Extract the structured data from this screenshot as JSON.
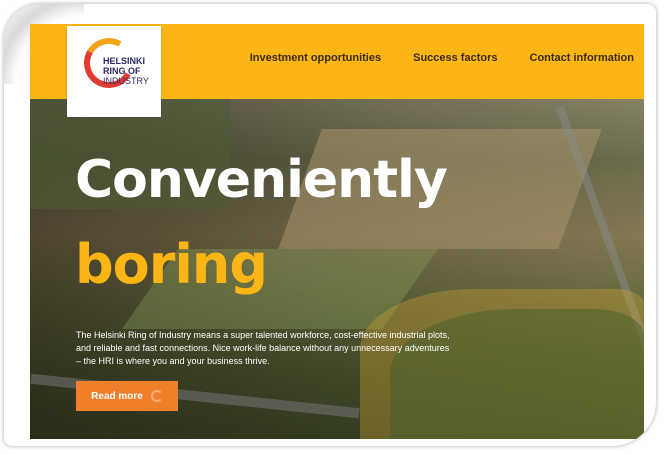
{
  "logo": {
    "line1": "HELSINKI",
    "line2": "RING OF",
    "line3": "INDUSTRY"
  },
  "nav": {
    "items": [
      {
        "label": "Investment opportunities"
      },
      {
        "label": "Success factors"
      },
      {
        "label": "Contact information"
      }
    ]
  },
  "hero": {
    "headline_line1": "Conveniently",
    "headline_line2": "boring",
    "description": "The Helsinki Ring of Industry means a super talented workforce, cost-effective industrial plots, and reliable and fast connections. Nice work-life balance without any unnecessary adventures – the HRI is where you and your business thrive.",
    "cta_label": "Read more"
  },
  "colors": {
    "brand_yellow": "#fbb616",
    "cta_orange": "#ef7f2a",
    "logo_navy": "#2c2a6b",
    "logo_red": "#e23b2f"
  },
  "icons": {
    "logo_mark": "ring-arc-icon",
    "cta_icon": "loading-spinner-icon"
  }
}
